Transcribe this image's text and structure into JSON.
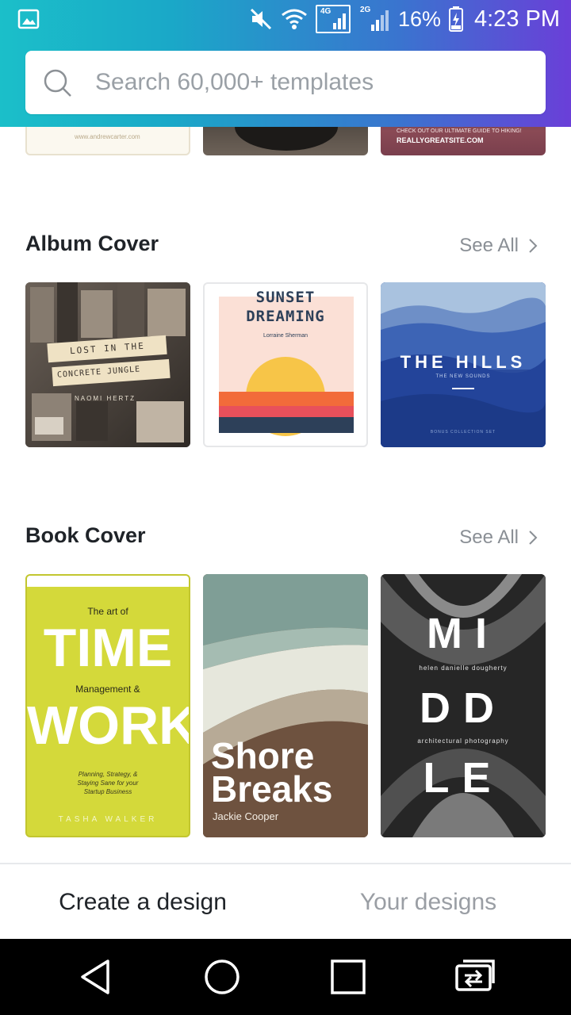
{
  "status_bar": {
    "network_4g": "4G",
    "network_2g": "2G",
    "battery": "16%",
    "time": "4:23 PM"
  },
  "search": {
    "placeholder": "Search 60,000+ templates"
  },
  "top_partial": {
    "card1_text": "www.andrewcarter.com",
    "card3_line1": "CHECK OUT OUR ULTIMATE GUIDE TO HIKING!",
    "card3_line2": "REALLYGREATSITE.COM"
  },
  "sections": [
    {
      "title": "Album Cover",
      "see_all": "See All",
      "cards": [
        {
          "line1": "LOST IN THE",
          "line2": "CONCRETE JUNGLE",
          "author": "NAOMI HERTZ"
        },
        {
          "title1": "SUNSET",
          "title2": "DREAMING",
          "author": "Lorraine Sherman"
        },
        {
          "title": "THE HILLS",
          "subtitle": "THE NEW SOUNDS",
          "footer": "BONUS COLLECTION SET"
        }
      ]
    },
    {
      "title": "Book Cover",
      "see_all": "See All",
      "cards": [
        {
          "pre": "The art of",
          "big1": "TIME",
          "mid": "Management &",
          "big2": "WORK",
          "tag1": "Planning, Strategy, &",
          "tag2": "Staying Sane for your",
          "tag3": "Startup Business",
          "author": "TASHA WALKER"
        },
        {
          "title1": "Shore",
          "title2": "Breaks",
          "author": "Jackie Cooper"
        },
        {
          "big1": "MI",
          "author": "helen danielle dougherty",
          "big2": "DD",
          "subtitle": "architectural photography",
          "big3": "LE"
        }
      ]
    }
  ],
  "tabs": {
    "create": "Create a design",
    "yours": "Your designs"
  },
  "colors": {
    "header_gradient_start": "#1bbfc9",
    "header_gradient_end": "#6a3fd8",
    "book_yellow": "#d4d93a",
    "sunset_orange": "#f26b3a",
    "sunset_navy": "#2d4059"
  }
}
